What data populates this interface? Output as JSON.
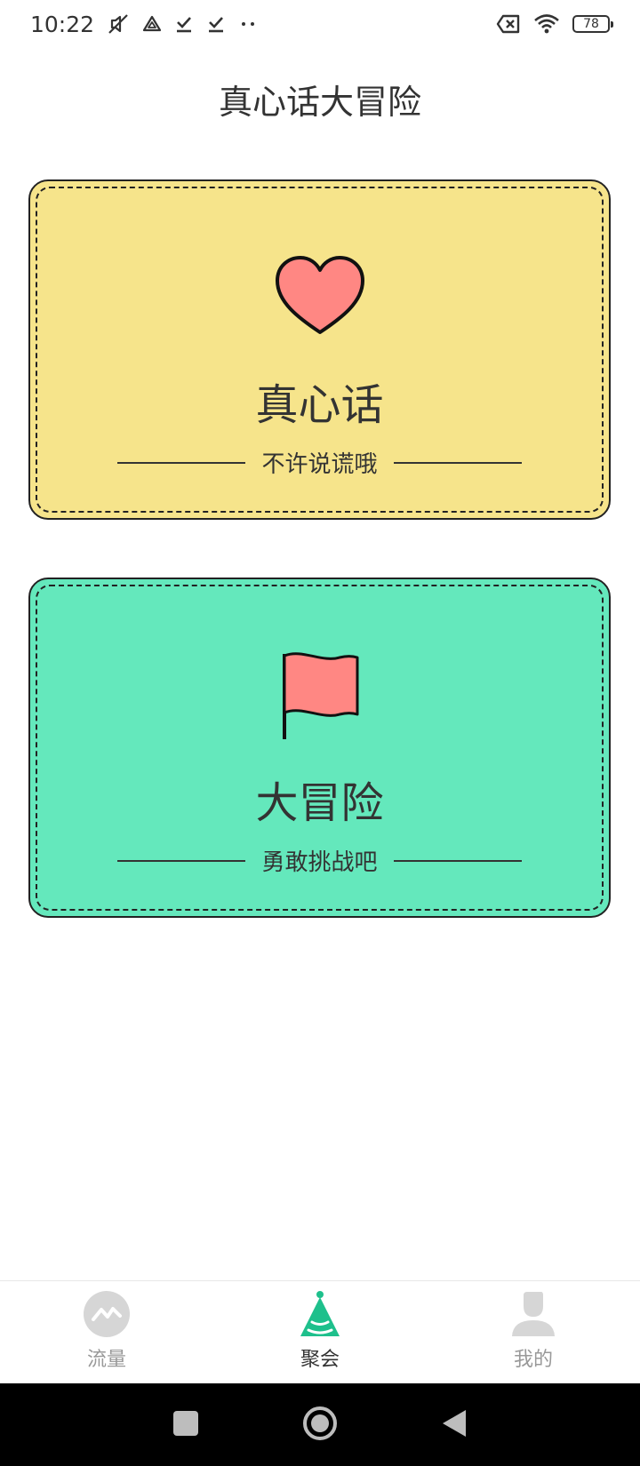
{
  "status_bar": {
    "time": "10:22",
    "icons_left": [
      "mute-icon",
      "drive-icon",
      "download-done-icon",
      "download-done-icon",
      "more-dots-icon"
    ],
    "icons_right": [
      "no-sim-icon",
      "wifi-icon",
      "battery-icon"
    ],
    "battery_level": "78"
  },
  "header": {
    "title": "真心话大冒险"
  },
  "cards": [
    {
      "id": "truth",
      "icon": "heart-icon",
      "title": "真心话",
      "subtitle": "不许说谎哦",
      "background": "#f6e48b",
      "icon_color": "#ff8783"
    },
    {
      "id": "dare",
      "icon": "flag-icon",
      "title": "大冒险",
      "subtitle": "勇敢挑战吧",
      "background": "#64e8bc",
      "icon_color": "#ff8783"
    }
  ],
  "bottom_nav": {
    "items": [
      {
        "label": "流量",
        "icon": "traffic-chart-icon",
        "active": false
      },
      {
        "label": "聚会",
        "icon": "party-hat-icon",
        "active": true
      },
      {
        "label": "我的",
        "icon": "profile-icon",
        "active": false
      }
    ],
    "active_color": "#1ec08c",
    "inactive_color": "#cccccc"
  },
  "system_nav": {
    "buttons": [
      "recents-button",
      "home-button",
      "back-button"
    ]
  }
}
